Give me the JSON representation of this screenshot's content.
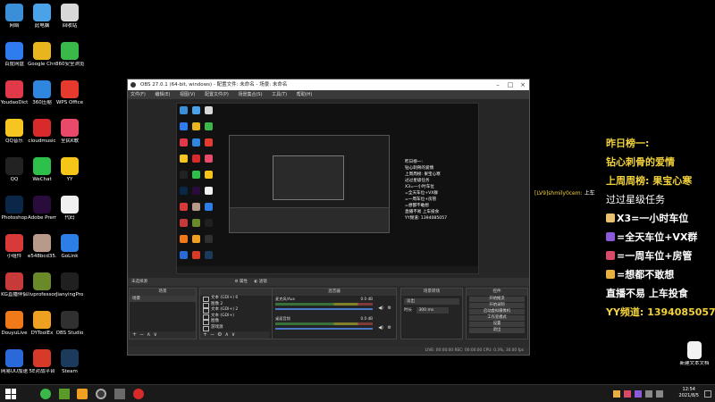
{
  "desktop": {
    "icons": [
      {
        "label": "网络",
        "color": "#3a8fd8"
      },
      {
        "label": "此电脑",
        "color": "#4aa3e8"
      },
      {
        "label": "回收站",
        "color": "#d8d8d8"
      },
      {
        "label": "百度网盘",
        "color": "#2f7cf0"
      },
      {
        "label": "Google Chrome",
        "color": "#e8b51e"
      },
      {
        "label": "360安全浏览器",
        "color": "#3bb84a"
      },
      {
        "label": "YoudaoDict",
        "color": "#e03a4a"
      },
      {
        "label": "360压缩",
        "color": "#2e86de"
      },
      {
        "label": "WPS Office",
        "color": "#e63a2e"
      },
      {
        "label": "QQ音乐",
        "color": "#f6c522"
      },
      {
        "label": "cloudmusic",
        "color": "#d82a2a"
      },
      {
        "label": "全民K歌",
        "color": "#e94a6a"
      },
      {
        "label": "QQ",
        "color": "#222222"
      },
      {
        "label": "WeChat",
        "color": "#2dc14b"
      },
      {
        "label": "YY",
        "color": "#f5c518"
      },
      {
        "label": "Photoshop",
        "color": "#0a2748"
      },
      {
        "label": "Adobe Premie...",
        "color": "#2a0c3c"
      },
      {
        "label": "代码",
        "color": "#f0f0f0"
      },
      {
        "label": "小组件",
        "color": "#d83a3a"
      },
      {
        "label": "e548bcd35...",
        "color": "#b89a8a"
      },
      {
        "label": "GoLink",
        "color": "#2e7ee8"
      },
      {
        "label": "KG直播伴侣",
        "color": "#c83a3a"
      },
      {
        "label": "livprofessor",
        "color": "#6a8a2a"
      },
      {
        "label": "JianyingPro",
        "color": "#202020"
      },
      {
        "label": "DouyuLive",
        "color": "#f07a1a"
      },
      {
        "label": "DYToolEx",
        "color": "#f0a020"
      },
      {
        "label": "OBS Studio",
        "color": "#303030"
      },
      {
        "label": "网易UU加速",
        "color": "#2a6ad8"
      },
      {
        "label": "5E对战平台",
        "color": "#d83a2a"
      },
      {
        "label": "Steam",
        "color": "#1b3a5c"
      }
    ],
    "right_file": "新建文本文档"
  },
  "obs": {
    "title": "OBS 27.0.1 (64-bit, windows) - 配置文件: 未命名 - 场景: 未命名",
    "menu": [
      "文件(F)",
      "编辑(E)",
      "视图(V)",
      "配置文件(P)",
      "场景集合(S)",
      "工具(T)",
      "帮助(H)"
    ],
    "toolbar": "未选择源",
    "toolbar_props": "属性",
    "toolbar_filters": "滤镜",
    "scenes_title": "场景",
    "scene_item": "场景",
    "sources_title": "来源",
    "sources": [
      "文本 (GDI+) 6",
      "图像 2",
      "文本 (GDI+) 2",
      "文本 (GDI+)",
      "图像",
      "游戏源"
    ],
    "mixer_title": "混音器",
    "mixer": [
      {
        "name": "麦克风/Aux",
        "db": "0.0 dB"
      },
      {
        "name": "桌面音频",
        "db": "0.0 dB"
      }
    ],
    "transitions_title": "场景转场",
    "transition_type": "淡出",
    "transition_duration_label": "时长",
    "transition_duration": "300 ms",
    "controls_title": "控件",
    "controls": [
      "开始推流",
      "开始录制",
      "启动虚拟摄像机",
      "工作室模式",
      "设置",
      "退出"
    ],
    "status": "LIVE: 00:00:00   REC: 00:00:00   CPU: 0.3%, 30.00 fps"
  },
  "preview_overlay": {
    "lines": [
      "昨日榜一:",
      "钻心刺骨的爱情",
      "上周周榜: 果宝心寒",
      "过过星级任务",
      "X3=一小时车位",
      "=全天车位+VX群",
      "=一周车位+房管",
      "=想都不敢想",
      "直播不易 上车投食",
      "YY频道: 1394085057"
    ]
  },
  "overlay": {
    "line1": "昨日榜一:",
    "line2": "钻心刺骨的爱情",
    "line3": "上周周榜: 果宝心寒",
    "line4": "过过星级任务",
    "line5": "X3=一小时车位",
    "line6": "=全天车位+VX群",
    "line7": "=一周车位+房管",
    "line8": "=想都不敢想",
    "line9": "直播不易 上车投食",
    "line10": "YY频道: 1394085057"
  },
  "chat": {
    "user": "[LV9]shmily0cem:",
    "message": "上车"
  },
  "taskbar": {
    "time": "12:54",
    "date": "2021/8/5"
  }
}
